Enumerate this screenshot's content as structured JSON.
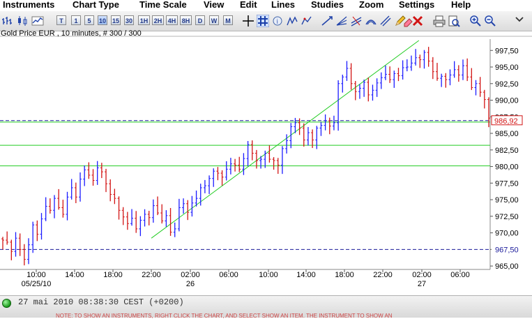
{
  "menu": {
    "items": [
      "Instruments",
      "Chart Type",
      "Time Scale",
      "View",
      "Edit",
      "Lines",
      "Studies",
      "Zoom",
      "Settings",
      "Help"
    ]
  },
  "toolbar": {
    "timeframes": [
      "T",
      "1",
      "5",
      "10",
      "15",
      "30",
      "1H",
      "2H",
      "4H",
      "8H",
      "D",
      "W",
      "M"
    ],
    "active_timeframe": "10"
  },
  "chart": {
    "title": "Gold Price EUR , 10 minutes, # 300 / 300",
    "last_price": "986,92",
    "low_marker": "967,50"
  },
  "status": {
    "datetime": "27 mai 2010 08:38:30  CEST (+0200)",
    "hint": "NOTE: TO SHOW AN INSTRUMENTS, RIGHT CLICK THE CHART, AND SELECT SHOW AN ITEM. THE INSTRUMENT TO SHOW AN"
  },
  "colors": {
    "bull_bar": "#1c1cff",
    "bear_bar": "#d21414",
    "trend_line": "#22cc22",
    "dashed_line": "#1a1a9a",
    "last_price_bg": "#ffffff",
    "last_price_fg": "#d21414",
    "low_marker_fg": "#1a1a9a"
  },
  "chart_data": {
    "type": "ohlc",
    "title": "Gold Price EUR , 10 minutes, # 300 / 300",
    "y_ticks": [
      "997,50",
      "995,00",
      "992,50",
      "990,00",
      "987,50",
      "985,00",
      "982,50",
      "980,00",
      "977,50",
      "975,00",
      "972,50",
      "970,00",
      "967,50",
      "965,00"
    ],
    "y_tick_values": [
      997.5,
      995.0,
      992.5,
      990.0,
      987.5,
      985.0,
      982.5,
      980.0,
      977.5,
      975.0,
      972.5,
      970.0,
      967.5,
      965.0
    ],
    "ylim": [
      964.8,
      999.0
    ],
    "x_ticks": [
      "10:00",
      "14:00",
      "18:00",
      "22:00",
      "02:00",
      "06:00",
      "10:00",
      "14:00",
      "18:00",
      "22:00",
      "02:00",
      "06:00"
    ],
    "x_date_labels": [
      {
        "date": "05/25/10",
        "under_tick": 0
      },
      {
        "date": "26",
        "under_tick": 4
      },
      {
        "date": "27",
        "under_tick": 10
      }
    ],
    "x_start": "2010-05-25 09:00",
    "x_end": "2010-05-27 08:40",
    "horizontal_lines": [
      {
        "value": 986.92,
        "style": "dashed",
        "color": "#1a1a9a"
      },
      {
        "value": 986.7,
        "style": "solid",
        "color": "#22cc22"
      },
      {
        "value": 983.2,
        "style": "solid",
        "color": "#22cc22"
      },
      {
        "value": 980.1,
        "style": "solid",
        "color": "#22cc22"
      },
      {
        "value": 967.5,
        "style": "dashed",
        "color": "#1a1a9a"
      }
    ],
    "trend_line": {
      "from": [
        "2010-05-25 23:40",
        969.2
      ],
      "to": [
        "2010-05-27 01:50",
        999.0
      ]
    },
    "closes": [
      968.9,
      968.6,
      967.2,
      969.2,
      967.5,
      966.0,
      968.2,
      971.2,
      969.8,
      972.1,
      974.0,
      973.4,
      975.2,
      973.8,
      972.8,
      975.4,
      976.8,
      975.4,
      978.1,
      979.5,
      978.7,
      977.9,
      979.8,
      979.2,
      977.4,
      975.8,
      975.2,
      973.4,
      972.4,
      971.4,
      972.2,
      970.6,
      971.9,
      972.8,
      972.3,
      974.1,
      973.0,
      971.8,
      972.6,
      970.1,
      970.6,
      973.8,
      974.4,
      973.1,
      974.5,
      975.2,
      976.8,
      977.1,
      978.2,
      979.3,
      979.0,
      978.4,
      979.6,
      980.4,
      980.2,
      979.6,
      981.2,
      983.3,
      982.0,
      980.9,
      981.1,
      982.0,
      981.1,
      980.9,
      980.2,
      982.7,
      983.9,
      986.0,
      986.6,
      985.8,
      984.0,
      985.1,
      984.0,
      985.8,
      986.2,
      986.9,
      986.1,
      986.6,
      992.5,
      993.5,
      994.8,
      992.5,
      991.3,
      991.8,
      992.7,
      990.8,
      991.5,
      992.6,
      993.4,
      993.9,
      993.1,
      994.0,
      993.7,
      994.9,
      995.0,
      995.6,
      996.4,
      996.1,
      997.2,
      995.9,
      994.3,
      993.3,
      993.6,
      993.1,
      993.8,
      994.6,
      993.8,
      995.2,
      993.5,
      991.9,
      992.5,
      991.2,
      990.1,
      987.3
    ]
  }
}
